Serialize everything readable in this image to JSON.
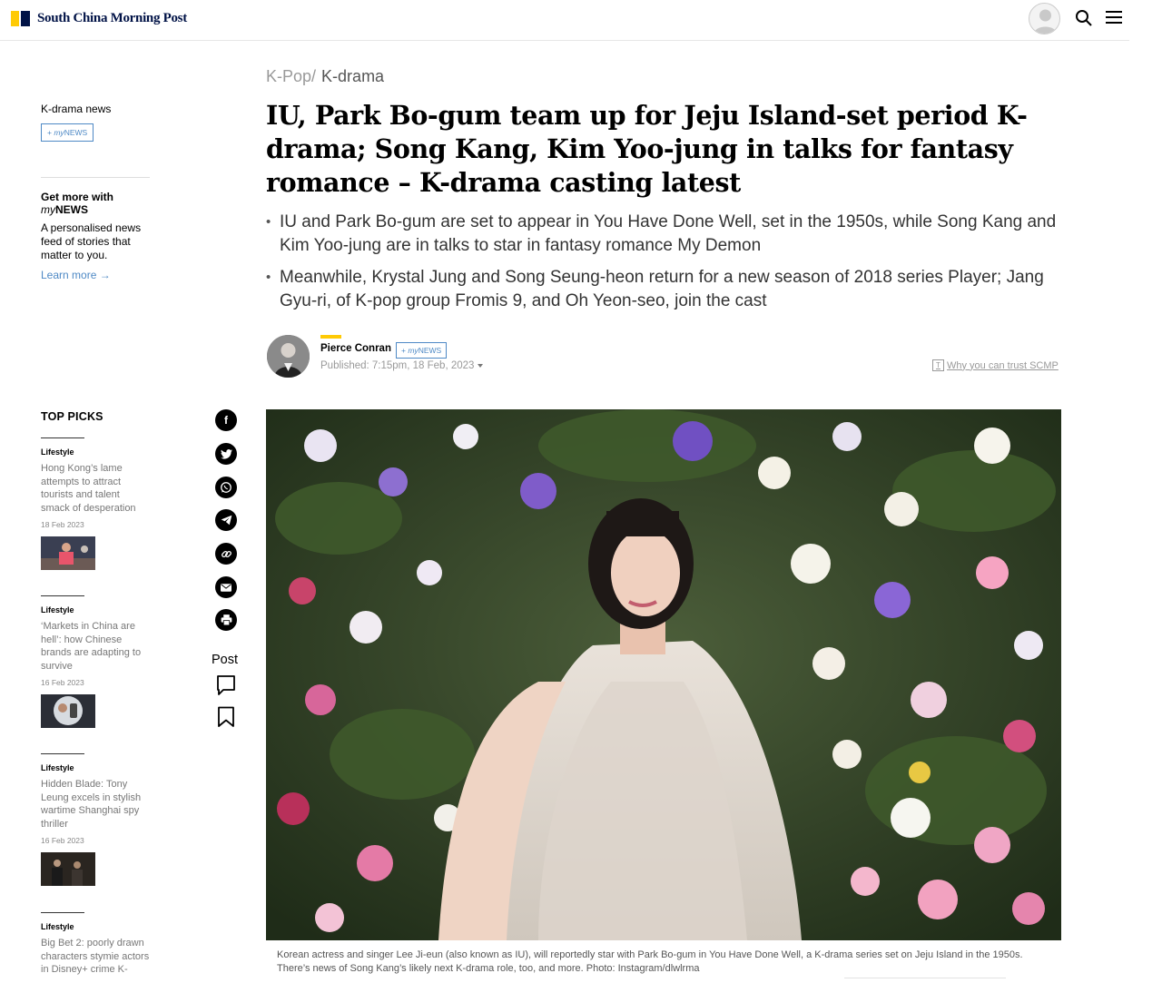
{
  "header": {
    "brand": "South China Morning Post"
  },
  "sidebar": {
    "section_label": "K-drama news",
    "mynews_button": {
      "plus": "+",
      "my": "my",
      "news": "NEWS"
    },
    "getmore": {
      "title_prefix": "Get more with",
      "title_my": "my",
      "title_news": "NEWS",
      "body": "A personalised news feed of stories that matter to you.",
      "link": "Learn more"
    },
    "top_picks_title": "TOP PICKS",
    "picks": [
      {
        "category": "Lifestyle",
        "title": "Hong Kong’s lame attempts to attract tourists and talent smack of desperation",
        "date": "18 Feb 2023"
      },
      {
        "category": "Lifestyle",
        "title": "‘Markets in China are hell’: how Chinese brands are adapting to survive",
        "date": "16 Feb 2023"
      },
      {
        "category": "Lifestyle",
        "title": "Hidden Blade: Tony Leung excels in stylish wartime Shanghai spy thriller",
        "date": "16 Feb 2023"
      },
      {
        "category": "Lifestyle",
        "title": "Big Bet 2: poorly drawn characters stymie actors in Disney+ crime K-"
      }
    ]
  },
  "share": {
    "icons": [
      "facebook-icon",
      "twitter-icon",
      "whatsapp-icon",
      "telegram-icon",
      "link-icon",
      "email-icon",
      "print-icon"
    ],
    "post_label": "Post"
  },
  "article": {
    "breadcrumb": {
      "parent": "K-Pop",
      "separator": "/",
      "current": "K-drama"
    },
    "headline": "IU, Park Bo-gum team up for Jeju Island-set period K-drama; Song Kang, Kim Yoo-jung in talks for fantasy romance – K-drama casting latest",
    "bullets": [
      "IU and Park Bo-gum are set to appear in You Have Done Well, set in the 1950s, while Song Kang and Kim Yoo-jung are in talks to star in fantasy romance My Demon",
      "Meanwhile, Krystal Jung and Song Seung-heon return for a new season of 2018 series Player; Jang Gyu-ri, of K-pop group Fromis 9, and Oh Yeon-seo, join the cast"
    ],
    "author": {
      "name": "Pierce Conran",
      "mynews": {
        "plus": "+",
        "my": "my",
        "news": "NEWS"
      },
      "published": "Published: 7:15pm, 18 Feb, 2023"
    },
    "trust_link": "Why you can trust SCMP",
    "caption": "Korean actress and singer Lee Ji-eun (also known as IU), will reportedly star with Park Bo-gum in You Have Done Well, a K-drama series set on Jeju Island in the 1950s. There’s news of Song Kang’s likely next K-drama role, too, and more. Photo: Instagram/dlwlrma"
  },
  "colors": {
    "brand_navy": "#001246",
    "brand_yellow": "#ffca05",
    "link_blue": "#4e89c5",
    "notification_red": "#e8222c"
  }
}
